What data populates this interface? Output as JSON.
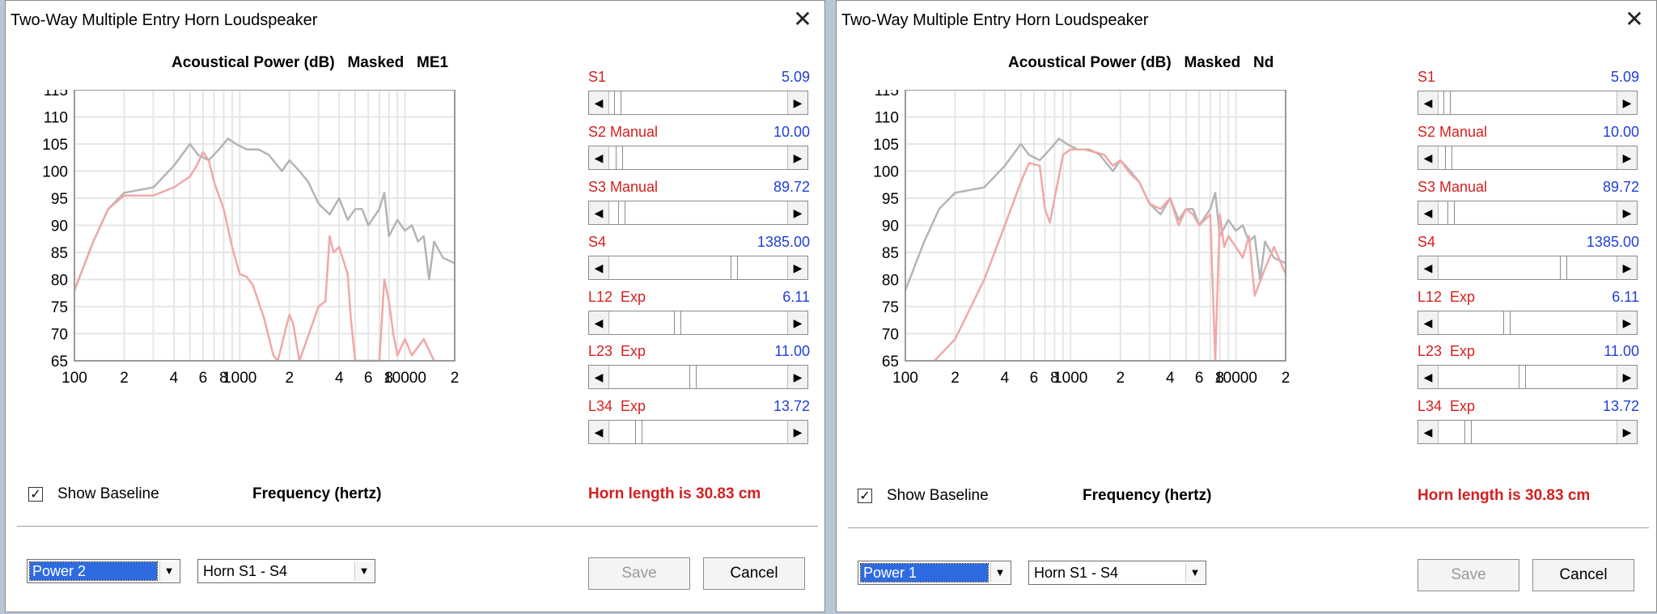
{
  "windows": [
    {
      "title": "Two-Way Multiple Entry Horn Loudspeaker",
      "close_glyph": "✕",
      "chart_title": "Acoustical Power (dB)   Masked   ME1",
      "controls": [
        {
          "label": "S1",
          "value": "5.09",
          "fraction": 0.03
        },
        {
          "label": "S2 Manual",
          "value": "10.00",
          "fraction": 0.04
        },
        {
          "label": "S3 Manual",
          "value": "89.72",
          "fraction": 0.05
        },
        {
          "label": "S4",
          "value": "1385.00",
          "fraction": 0.71
        },
        {
          "label": "L12  Exp",
          "value": "6.11",
          "fraction": 0.38
        },
        {
          "label": "L23  Exp",
          "value": "11.00",
          "fraction": 0.47
        },
        {
          "label": "L34  Exp",
          "value": "13.72",
          "fraction": 0.15
        }
      ],
      "show_baseline_label": "Show Baseline",
      "show_baseline_checked": true,
      "frequency_label": "Frequency (hertz)",
      "horn_length": "Horn length is 30.83 cm",
      "power_select": "Power 2",
      "horn_select": "Horn S1 - S4",
      "save_label": "Save",
      "cancel_label": "Cancel"
    },
    {
      "title": "Two-Way Multiple Entry Horn Loudspeaker",
      "close_glyph": "✕",
      "chart_title": "Acoustical Power (dB)   Masked   Nd",
      "controls": [
        {
          "label": "S1",
          "value": "5.09",
          "fraction": 0.03
        },
        {
          "label": "S2 Manual",
          "value": "10.00",
          "fraction": 0.04
        },
        {
          "label": "S3 Manual",
          "value": "89.72",
          "fraction": 0.05
        },
        {
          "label": "S4",
          "value": "1385.00",
          "fraction": 0.71
        },
        {
          "label": "L12  Exp",
          "value": "6.11",
          "fraction": 0.38
        },
        {
          "label": "L23  Exp",
          "value": "11.00",
          "fraction": 0.47
        },
        {
          "label": "L34  Exp",
          "value": "13.72",
          "fraction": 0.15
        }
      ],
      "show_baseline_label": "Show Baseline",
      "show_baseline_checked": true,
      "frequency_label": "Frequency (hertz)",
      "horn_length": "Horn length is 30.83 cm",
      "power_select": "Power 1",
      "horn_select": "Horn S1 - S4",
      "save_label": "Save",
      "cancel_label": "Cancel"
    }
  ],
  "colors": {
    "baseline": "#b4b4b4",
    "masked": "#f0a8a8",
    "grid": "#e6e6e6",
    "label_red": "#d42020",
    "value_blue": "#1f3fd8"
  },
  "chart_data": [
    {
      "type": "line",
      "title": "Acoustical Power (dB)   Masked   ME1",
      "xlabel": "Frequency (hertz)",
      "ylabel": "",
      "xscale": "log",
      "xlim": [
        100,
        20000
      ],
      "ylim": [
        65,
        115
      ],
      "yticks": [
        65,
        70,
        75,
        80,
        85,
        90,
        95,
        100,
        105,
        110,
        115
      ],
      "xtick_labels": [
        "100",
        "2",
        "4",
        "6",
        "8",
        "1000",
        "2",
        "4",
        "6",
        "8",
        "10000",
        "2"
      ],
      "grid": true,
      "series": [
        {
          "color": "baseline",
          "points": [
            [
              100,
              78
            ],
            [
              130,
              87
            ],
            [
              160,
              93
            ],
            [
              200,
              96
            ],
            [
              300,
              97
            ],
            [
              400,
              101
            ],
            [
              500,
              105
            ],
            [
              560,
              103
            ],
            [
              650,
              102
            ],
            [
              750,
              104
            ],
            [
              850,
              106
            ],
            [
              950,
              105
            ],
            [
              1100,
              104
            ],
            [
              1300,
              104
            ],
            [
              1500,
              103
            ],
            [
              1800,
              100
            ],
            [
              2000,
              102
            ],
            [
              2300,
              100
            ],
            [
              2600,
              98
            ],
            [
              3000,
              94
            ],
            [
              3500,
              92
            ],
            [
              4000,
              95
            ],
            [
              4500,
              91
            ],
            [
              5000,
              93
            ],
            [
              5500,
              93
            ],
            [
              6000,
              90
            ],
            [
              7000,
              93
            ],
            [
              7500,
              96
            ],
            [
              8000,
              88
            ],
            [
              9000,
              91
            ],
            [
              10000,
              89
            ],
            [
              11000,
              90
            ],
            [
              12000,
              87
            ],
            [
              13000,
              88
            ],
            [
              14000,
              80
            ],
            [
              15000,
              87
            ],
            [
              17000,
              84
            ],
            [
              20000,
              83
            ]
          ]
        },
        {
          "color": "masked",
          "points": [
            [
              100,
              78
            ],
            [
              130,
              87
            ],
            [
              160,
              93
            ],
            [
              200,
              95.5
            ],
            [
              300,
              95.5
            ],
            [
              400,
              97
            ],
            [
              500,
              99
            ],
            [
              550,
              101
            ],
            [
              600,
              103.5
            ],
            [
              650,
              102
            ],
            [
              700,
              98
            ],
            [
              800,
              93
            ],
            [
              900,
              86
            ],
            [
              1000,
              81
            ],
            [
              1100,
              80.5
            ],
            [
              1200,
              79
            ],
            [
              1400,
              73
            ],
            [
              1600,
              66
            ],
            [
              1700,
              65
            ],
            [
              1800,
              68
            ],
            [
              1900,
              71
            ],
            [
              2000,
              73.5
            ],
            [
              2100,
              72
            ],
            [
              2300,
              65
            ],
            [
              3000,
              75
            ],
            [
              3300,
              76
            ],
            [
              3500,
              88
            ],
            [
              3700,
              85
            ],
            [
              4000,
              86
            ],
            [
              4500,
              81
            ],
            [
              4700,
              73
            ],
            [
              5000,
              65
            ],
            [
              7000,
              65
            ],
            [
              7500,
              80
            ],
            [
              8000,
              76
            ],
            [
              8500,
              70
            ],
            [
              9000,
              66
            ],
            [
              10000,
              69
            ],
            [
              11000,
              66
            ],
            [
              13000,
              69
            ],
            [
              15000,
              65
            ]
          ]
        }
      ]
    },
    {
      "type": "line",
      "title": "Acoustical Power (dB)   Masked   Nd",
      "xlabel": "Frequency (hertz)",
      "ylabel": "",
      "xscale": "log",
      "xlim": [
        100,
        20000
      ],
      "ylim": [
        65,
        115
      ],
      "yticks": [
        65,
        70,
        75,
        80,
        85,
        90,
        95,
        100,
        105,
        110,
        115
      ],
      "xtick_labels": [
        "100",
        "2",
        "4",
        "6",
        "8",
        "1000",
        "2",
        "4",
        "6",
        "8",
        "10000",
        "2"
      ],
      "grid": true,
      "series": [
        {
          "color": "baseline",
          "points": [
            [
              100,
              78
            ],
            [
              130,
              87
            ],
            [
              160,
              93
            ],
            [
              200,
              96
            ],
            [
              300,
              97
            ],
            [
              400,
              101
            ],
            [
              500,
              105
            ],
            [
              560,
              103
            ],
            [
              650,
              102
            ],
            [
              750,
              104
            ],
            [
              850,
              106
            ],
            [
              950,
              105
            ],
            [
              1100,
              104
            ],
            [
              1300,
              104
            ],
            [
              1500,
              103
            ],
            [
              1800,
              100
            ],
            [
              2000,
              102
            ],
            [
              2300,
              100
            ],
            [
              2600,
              98
            ],
            [
              3000,
              94
            ],
            [
              3500,
              92
            ],
            [
              4000,
              95
            ],
            [
              4500,
              91
            ],
            [
              5000,
              93
            ],
            [
              5500,
              93
            ],
            [
              6000,
              90
            ],
            [
              7000,
              93
            ],
            [
              7500,
              96
            ],
            [
              8000,
              88
            ],
            [
              9000,
              91
            ],
            [
              10000,
              89
            ],
            [
              11000,
              90
            ],
            [
              12000,
              87
            ],
            [
              13000,
              88
            ],
            [
              14000,
              80
            ],
            [
              15000,
              87
            ],
            [
              17000,
              84
            ],
            [
              20000,
              83
            ]
          ]
        },
        {
          "color": "masked",
          "points": [
            [
              150,
              65
            ],
            [
              200,
              69
            ],
            [
              300,
              80
            ],
            [
              400,
              90
            ],
            [
              500,
              98
            ],
            [
              560,
              101.5
            ],
            [
              650,
              101
            ],
            [
              700,
              93
            ],
            [
              750,
              90.5
            ],
            [
              800,
              95
            ],
            [
              900,
              103
            ],
            [
              1000,
              104
            ],
            [
              1200,
              104
            ],
            [
              1400,
              103.5
            ],
            [
              1600,
              103
            ],
            [
              1800,
              101
            ],
            [
              2000,
              102
            ],
            [
              2300,
              99.5
            ],
            [
              2600,
              98
            ],
            [
              3000,
              94
            ],
            [
              3500,
              93
            ],
            [
              4000,
              95
            ],
            [
              4500,
              90
            ],
            [
              5000,
              93
            ],
            [
              5500,
              92
            ],
            [
              6000,
              90
            ],
            [
              7000,
              92
            ],
            [
              7500,
              65
            ],
            [
              8000,
              92
            ],
            [
              8500,
              86
            ],
            [
              9000,
              88
            ],
            [
              10000,
              86
            ],
            [
              11000,
              84
            ],
            [
              12000,
              88
            ],
            [
              13000,
              77
            ],
            [
              15000,
              82
            ],
            [
              17000,
              86
            ],
            [
              20000,
              81
            ]
          ]
        }
      ]
    }
  ]
}
